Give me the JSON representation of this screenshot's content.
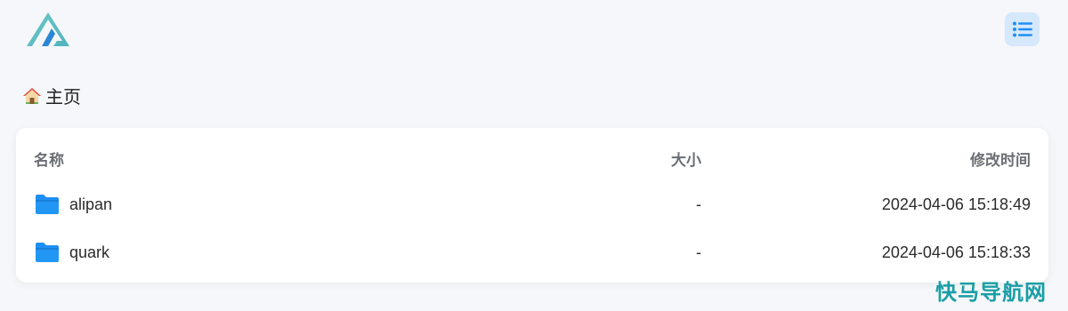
{
  "app": {
    "logo_icon": "alist-logo-icon",
    "menu_icon": "list-menu-icon"
  },
  "breadcrumb": {
    "icon": "home-icon",
    "label": "主页"
  },
  "table": {
    "headers": {
      "name": "名称",
      "size": "大小",
      "modified": "修改时间"
    },
    "rows": [
      {
        "icon": "folder-icon",
        "name": "alipan",
        "size": "-",
        "modified": "2024-04-06 15:18:49"
      },
      {
        "icon": "folder-icon",
        "name": "quark",
        "size": "-",
        "modified": "2024-04-06 15:18:33"
      }
    ]
  },
  "watermark": {
    "text": "快马导航网"
  },
  "colors": {
    "accent": "#1e8ff5",
    "logo": "#5bbec5",
    "menu_bg": "#d6e8fb"
  }
}
